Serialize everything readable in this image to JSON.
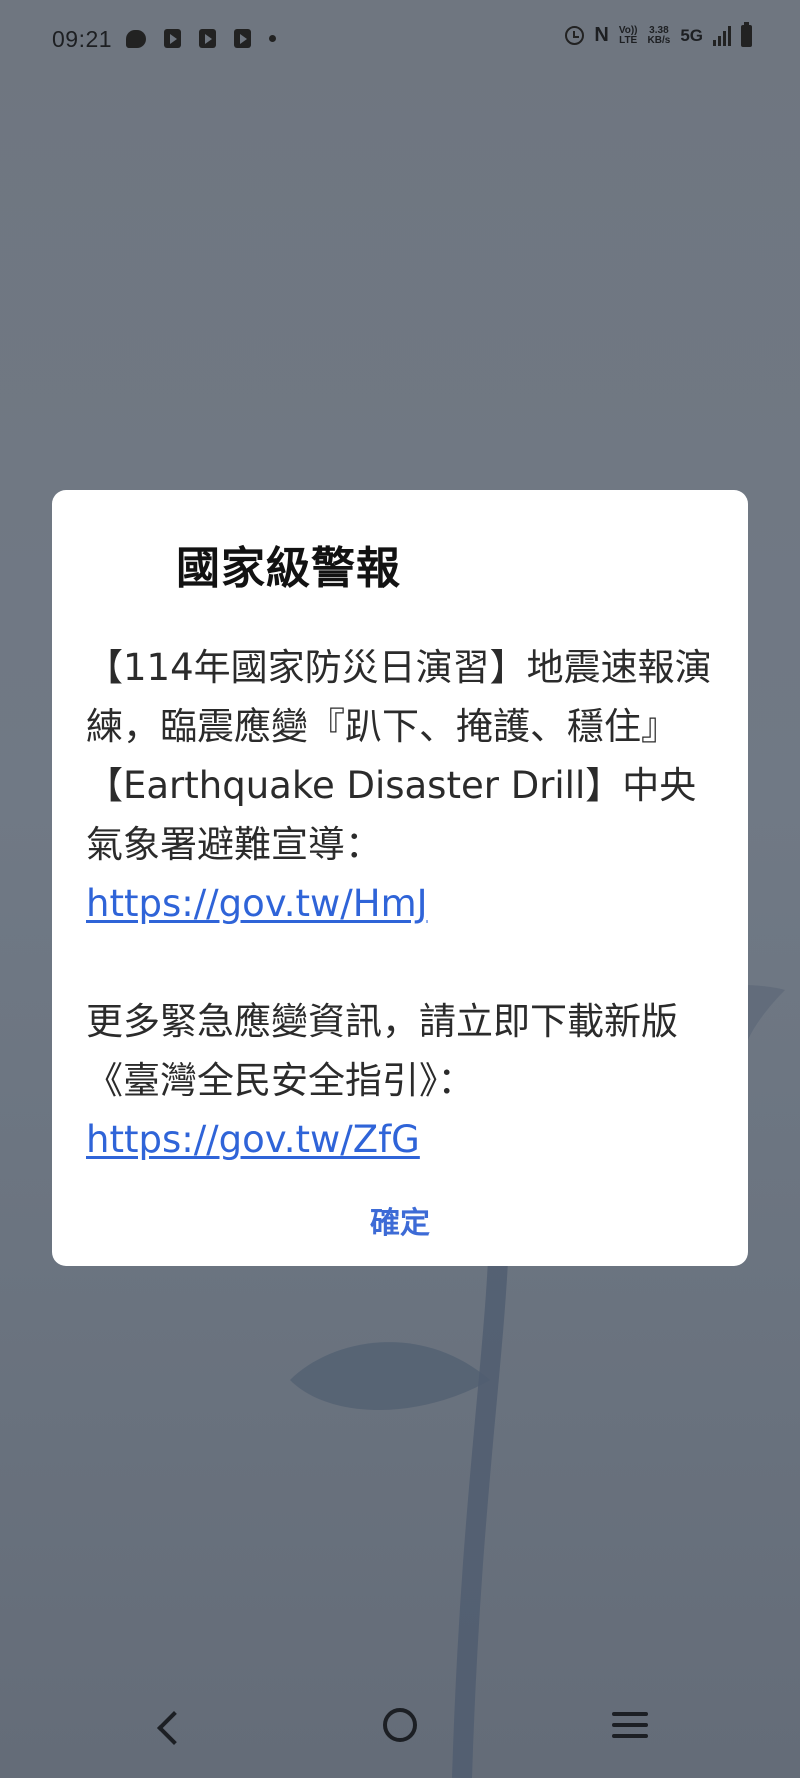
{
  "status_bar": {
    "time": "09:21",
    "network_speed_value": "3.38",
    "network_speed_unit": "KB/s",
    "volte_top": "Vo))",
    "volte_bottom": "LTE",
    "nfc": "N",
    "network_type": "5G",
    "icons": [
      "chat-icon",
      "play-icon",
      "play-icon",
      "play-icon",
      "dot-icon",
      "alarm-icon",
      "nfc-icon",
      "volte-icon",
      "signal-icon",
      "battery-icon"
    ]
  },
  "dialog": {
    "title": "國家級警報",
    "paragraph1_text": "【114年國家防災日演習】地震速報演練，臨震應變『趴下、掩護、穩住』【Earthquake Disaster Drill】中央氣象署避難宣導：",
    "paragraph1_link": "https://gov.tw/HmJ",
    "paragraph2_text": "更多緊急應變資訊，請立即下載新版《臺灣全民安全指引》：",
    "paragraph2_link": "https://gov.tw/ZfG",
    "ok_label": "確定"
  },
  "nav_bar": {
    "icons": [
      "back-icon",
      "home-icon",
      "menu-icon"
    ]
  },
  "colors": {
    "background": "#6f7680",
    "dialog_background": "#ffffff",
    "link": "#2f64d8",
    "button": "#3d6bd6"
  }
}
